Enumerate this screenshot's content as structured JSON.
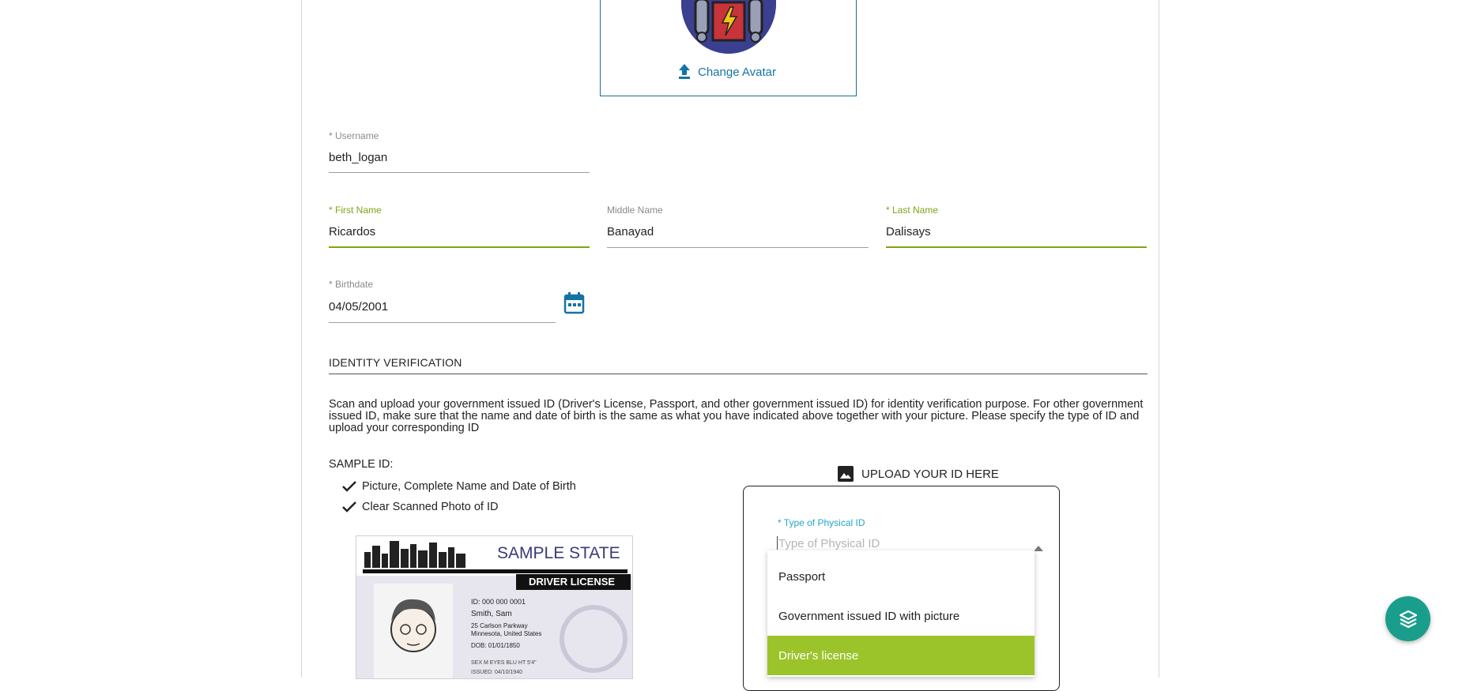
{
  "avatar": {
    "change_label": "Change Avatar"
  },
  "username": {
    "label": "* Username",
    "value": "beth_logan"
  },
  "first_name": {
    "label": "* First Name",
    "value": "Ricardos"
  },
  "middle_name": {
    "label": "Middle Name",
    "value": "Banayad"
  },
  "last_name": {
    "label": "* Last Name",
    "value": "Dalisays"
  },
  "birthdate": {
    "label": "* Birthdate",
    "value": "04/05/2001"
  },
  "identity": {
    "title": "IDENTITY VERIFICATION",
    "description": "Scan and upload your government issued ID (Driver's License, Passport, and other government issued ID) for identity verification purpose. For other government issued ID, make sure that the name and date of birth is the same as what you have indicated above together with your picture. Please specify the type of ID and upload your corresponding ID",
    "sample_heading": "SAMPLE ID:",
    "checks": [
      "Picture, Complete Name and Date of Birth",
      "Clear Scanned Photo of ID"
    ]
  },
  "sample_card": {
    "state": "SAMPLE STATE",
    "type": "DRIVER LICENSE",
    "id_line": "ID: 000 000 0001",
    "name": "Smith, Sam",
    "address1": "25 Carlson Parkway",
    "address2": "Minnesota, United States",
    "dob": "DOB: 01/01/1850",
    "extra1": "SEX M  EYES BLU  HT 5'4\"",
    "extra2": "ISSUED: 04/10/1940"
  },
  "upload": {
    "title": "UPLOAD YOUR ID HERE",
    "type_label": "* Type of Physical ID",
    "type_placeholder": "Type of Physical ID",
    "options": [
      "Passport",
      "Government issued ID with picture",
      "Driver's license"
    ],
    "selected_index": 2
  },
  "colors": {
    "accent_green": "#7fa516",
    "selected_green": "#9bc42b",
    "link_blue": "#1473a6",
    "fab_teal": "#1a9e8c"
  }
}
